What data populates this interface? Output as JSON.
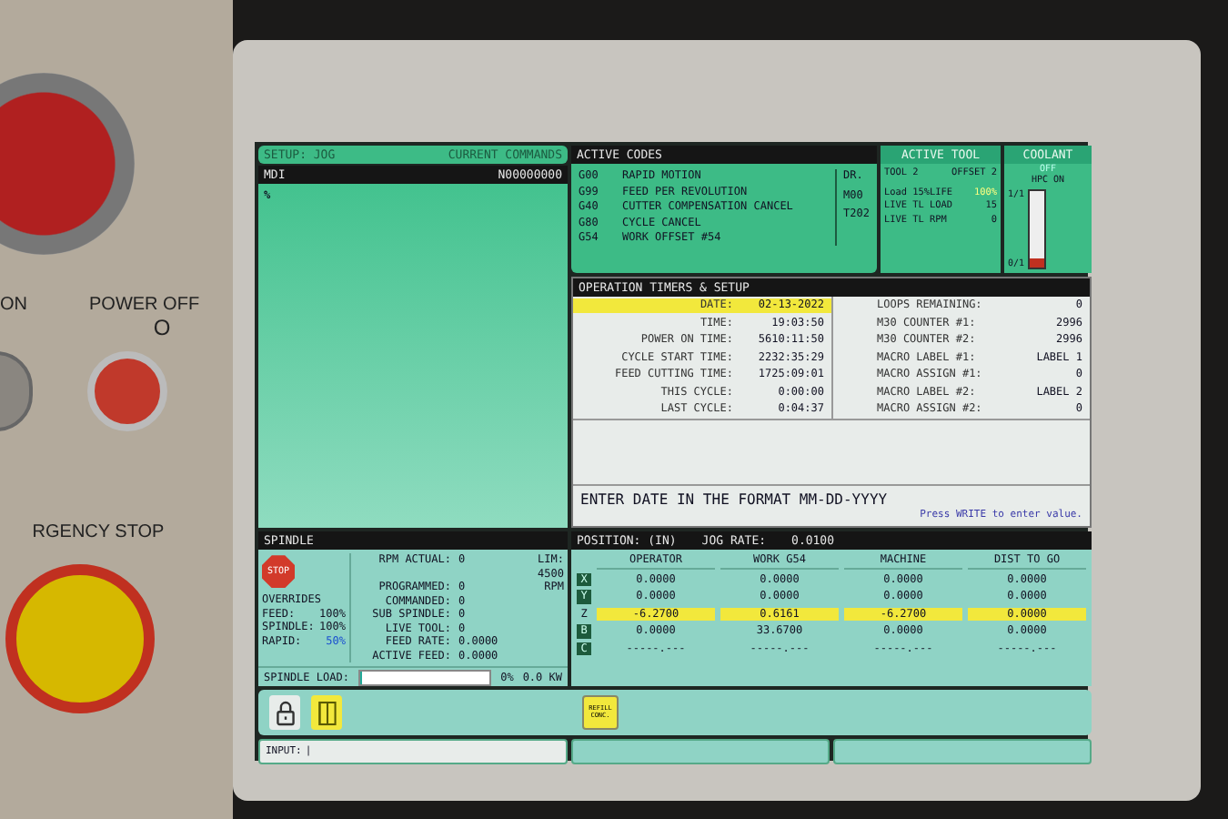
{
  "machine_panel": {
    "labels": [
      {
        "kind": "label",
        "text": "ON"
      },
      {
        "kind": "label",
        "text": "POWER OFF"
      },
      {
        "kind": "symbol",
        "text": "O"
      },
      {
        "kind": "label",
        "text": "RGENCY STOP"
      }
    ]
  },
  "screen": {
    "status_bar": {
      "mode": "SETUP: JOG",
      "title": "CURRENT COMMANDS"
    },
    "mdi": {
      "title": "MDI",
      "block": "N00000000",
      "content": "%"
    },
    "active_codes": {
      "title": "ACTIVE CODES",
      "codes": [
        {
          "code": "G00",
          "description": "RAPID MOTION"
        },
        {
          "code": "G99",
          "description": "FEED PER REVOLUTION"
        },
        {
          "code": "G40",
          "description": "CUTTER COMPENSATION CANCEL"
        },
        {
          "code": "G80",
          "description": "CYCLE CANCEL"
        },
        {
          "code": "G54",
          "description": "WORK OFFSET  #54"
        }
      ],
      "side": [
        "DR.",
        "M00",
        "T202"
      ]
    },
    "active_tool": {
      "title": "ACTIVE TOOL",
      "tool": "TOOL 2",
      "offset": "OFFSET 2",
      "rows": [
        {
          "label": "Load 15%LIFE",
          "value": "100%",
          "highlight": true
        },
        {
          "label": "LIVE TL LOAD",
          "value": "15",
          "highlight": false
        },
        {
          "label": "LIVE TL RPM",
          "value": "0",
          "highlight": false
        }
      ]
    },
    "coolant": {
      "title": "COOLANT",
      "state": "OFF",
      "mode": "HPC ON",
      "top": "1/1",
      "bottom": "0/1",
      "level": 0.12
    },
    "timers": {
      "title": "OPERATION TIMERS & SETUP",
      "left": [
        {
          "label": "DATE:",
          "value": "02-13-2022",
          "selected": true
        },
        {
          "label": "TIME:",
          "value": "19:03:50",
          "selected": false
        },
        {
          "label": "POWER ON TIME:",
          "value": "5610:11:50",
          "selected": false
        },
        {
          "label": "CYCLE START TIME:",
          "value": "2232:35:29",
          "selected": false
        },
        {
          "label": "FEED CUTTING TIME:",
          "value": "1725:09:01",
          "selected": false
        },
        {
          "label": "THIS CYCLE:",
          "value": "0:00:00",
          "selected": false
        },
        {
          "label": "LAST CYCLE:",
          "value": "0:04:37",
          "selected": false
        }
      ],
      "right": [
        {
          "label": "LOOPS REMAINING:",
          "value": "0",
          "selected": false
        },
        {
          "label": "M30 COUNTER #1:",
          "value": "2996",
          "selected": false
        },
        {
          "label": "M30 COUNTER #2:",
          "value": "2996",
          "selected": false
        },
        {
          "label": "MACRO LABEL #1:",
          "value": "LABEL 1",
          "selected": false
        },
        {
          "label": "MACRO ASSIGN #1:",
          "value": "0",
          "selected": false
        },
        {
          "label": "MACRO LABEL #2:",
          "value": "LABEL 2",
          "selected": false
        },
        {
          "label": "MACRO ASSIGN #2:",
          "value": "0",
          "selected": false
        }
      ],
      "prompt": "ENTER DATE IN THE FORMAT MM-DD-YYYY",
      "hint": "Press WRITE to enter value."
    },
    "spindle": {
      "title": "SPINDLE",
      "stop": "STOP",
      "overrides_title": "OVERRIDES",
      "overrides": [
        {
          "label": "FEED:",
          "value": "100%",
          "highlight": false
        },
        {
          "label": "SPINDLE:",
          "value": "100%",
          "highlight": false
        },
        {
          "label": "RAPID:",
          "value": "50%",
          "highlight": true
        }
      ],
      "readings": [
        {
          "label": "RPM ACTUAL:",
          "value": "0",
          "extra": "LIM: 4500"
        },
        {
          "label": "PROGRAMMED:",
          "value": "0",
          "extra": "RPM"
        },
        {
          "label": "COMMANDED:",
          "value": "0"
        },
        {
          "label": "SUB SPINDLE:",
          "value": "0"
        },
        {
          "label": "LIVE TOOL:",
          "value": "0"
        },
        {
          "label": "FEED RATE:",
          "value": "0.0000"
        },
        {
          "label": "ACTIVE FEED:",
          "value": "0.0000"
        }
      ],
      "load": {
        "label": "SPINDLE LOAD:",
        "level": 0,
        "percent": "0%",
        "power": "0.0 KW"
      }
    },
    "position": {
      "title": "POSITION: (IN)",
      "jog_label": "JOG RATE:",
      "jog_rate": "0.0100",
      "columns": [
        "OPERATOR",
        "WORK G54",
        "MACHINE",
        "DIST TO GO"
      ],
      "rows": [
        {
          "axis": "X",
          "values": [
            "0.0000",
            "0.0000",
            "0.0000",
            "0.0000"
          ],
          "selected": false
        },
        {
          "axis": "Y",
          "values": [
            "0.0000",
            "0.0000",
            "0.0000",
            "0.0000"
          ],
          "selected": false
        },
        {
          "axis": "Z",
          "values": [
            "-6.2700",
            "0.6161",
            "-6.2700",
            "0.0000"
          ],
          "selected": true
        },
        {
          "axis": "B",
          "values": [
            "0.0000",
            "33.6700",
            "0.0000",
            "0.0000"
          ],
          "selected": false
        },
        {
          "axis": "C",
          "values": [
            "-----.---",
            "-----.---",
            "-----.---",
            "-----.---"
          ],
          "selected": false
        }
      ]
    },
    "icon_bar": {
      "buttons": [
        {
          "kind": "lock"
        },
        {
          "kind": "door"
        },
        {
          "kind": "refill",
          "text": "REFILL CONC."
        }
      ]
    },
    "input": {
      "label": "INPUT:",
      "value": "|"
    }
  }
}
